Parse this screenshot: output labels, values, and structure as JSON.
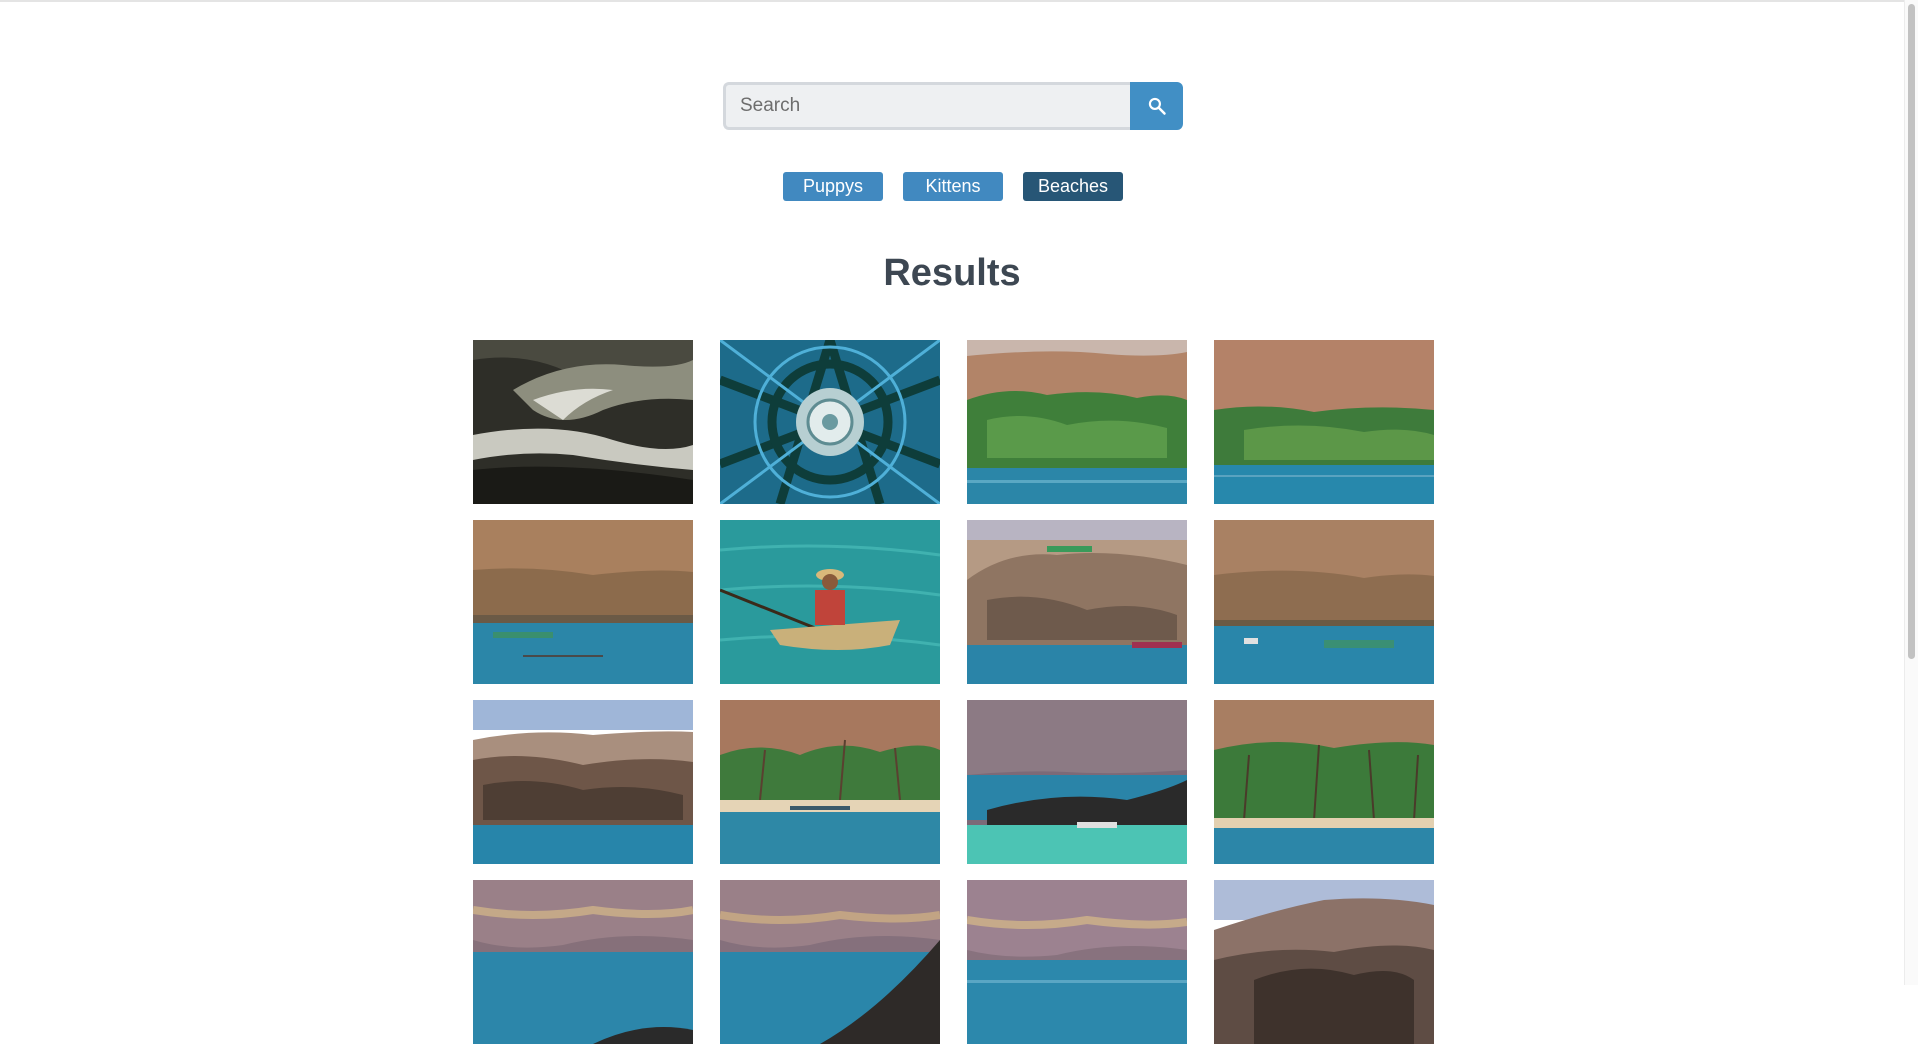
{
  "search": {
    "placeholder": "Search",
    "button_icon": "search-icon"
  },
  "tags": [
    {
      "label": "Puppys",
      "active": false
    },
    {
      "label": "Kittens",
      "active": false
    },
    {
      "label": "Beaches",
      "active": true
    }
  ],
  "results": {
    "title": "Results",
    "images": [
      {
        "subject": "wave curl"
      },
      {
        "subject": "kaleidoscope pattern"
      },
      {
        "subject": "hillside with trees over sea"
      },
      {
        "subject": "hillside with trees over sea"
      },
      {
        "subject": "cliff with boats"
      },
      {
        "subject": "man paddling canoe"
      },
      {
        "subject": "rocky headland"
      },
      {
        "subject": "cliff with boats"
      },
      {
        "subject": "rocky coast"
      },
      {
        "subject": "palm beach"
      },
      {
        "subject": "rocky cove"
      },
      {
        "subject": "palm beach"
      },
      {
        "subject": "cliffs over sea"
      },
      {
        "subject": "cliffs over sea"
      },
      {
        "subject": "cliffs over sea"
      },
      {
        "subject": "rocky coast"
      }
    ]
  },
  "colors": {
    "accent": "#418fc5",
    "tag": "#4189c0",
    "tag_active": "#275676",
    "title": "#3d4752"
  }
}
